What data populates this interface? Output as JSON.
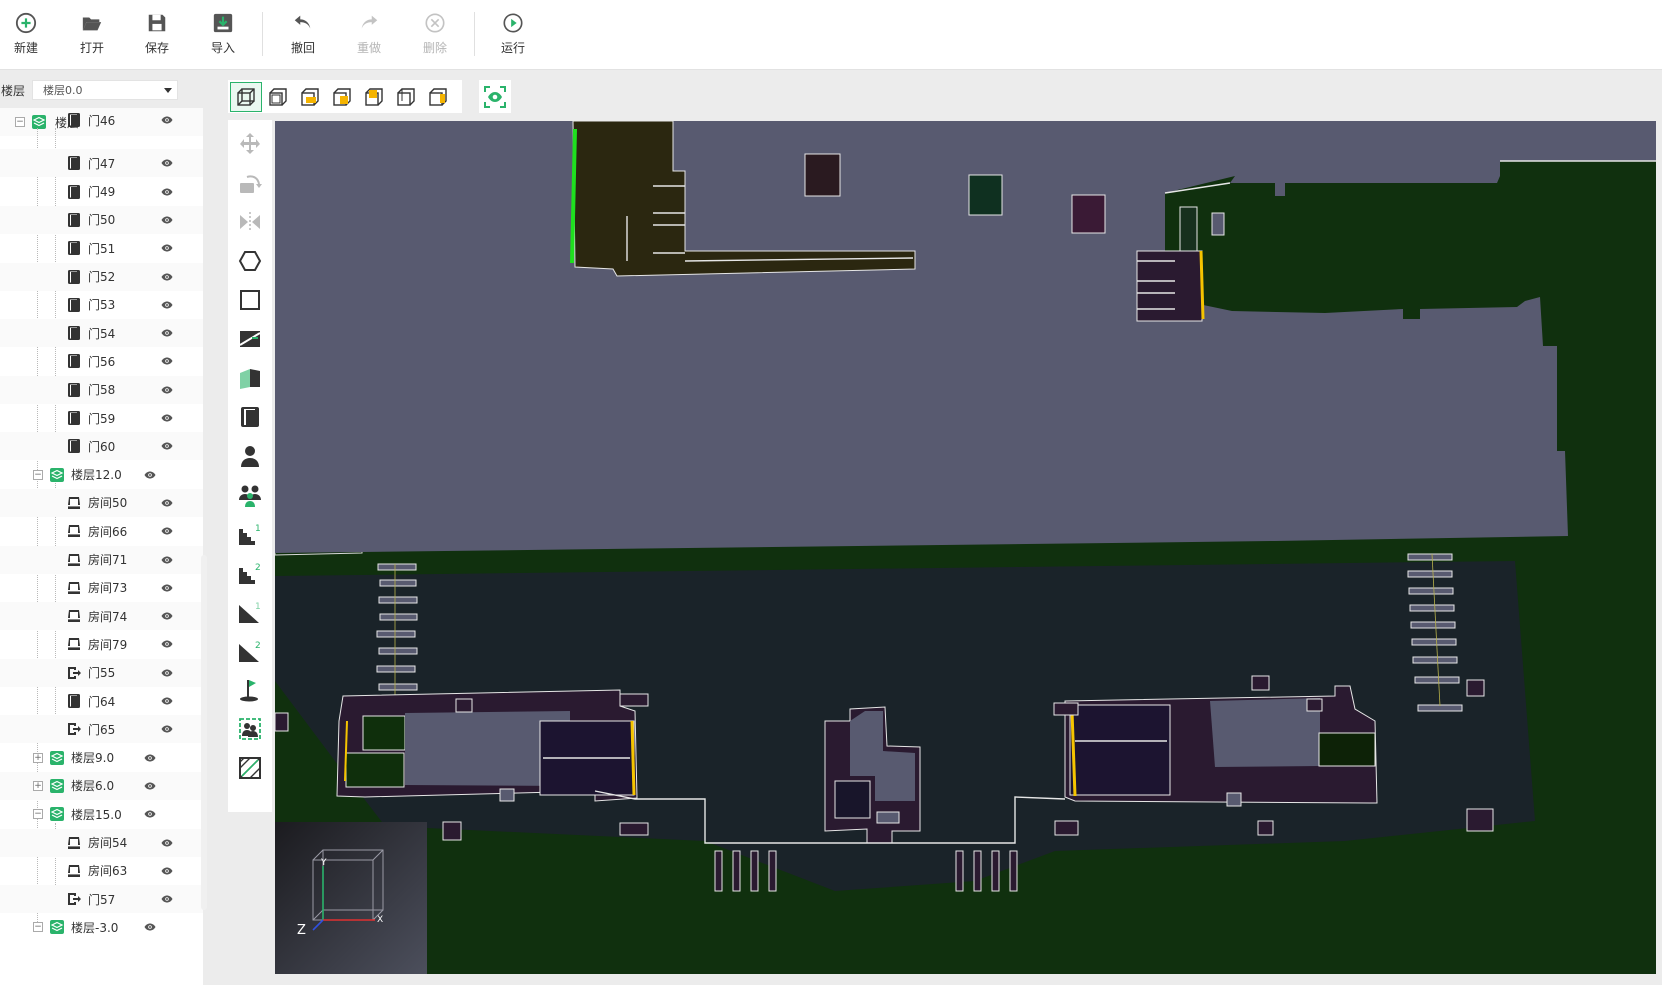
{
  "toolbar": {
    "new": "新建",
    "open": "打开",
    "save": "保存",
    "import": "导入",
    "undo": "撤回",
    "redo": "重做",
    "delete": "删除",
    "run": "运行"
  },
  "floor_selector": {
    "label": "楼层",
    "value": "楼层0.0"
  },
  "tree": {
    "root": "楼层",
    "items": [
      {
        "label": "门46",
        "type": "door"
      },
      {
        "label": "门47",
        "type": "door"
      },
      {
        "label": "门49",
        "type": "door"
      },
      {
        "label": "门50",
        "type": "door"
      },
      {
        "label": "门51",
        "type": "door"
      },
      {
        "label": "门52",
        "type": "door"
      },
      {
        "label": "门53",
        "type": "door"
      },
      {
        "label": "门54",
        "type": "door"
      },
      {
        "label": "门56",
        "type": "door"
      },
      {
        "label": "门58",
        "type": "door"
      },
      {
        "label": "门59",
        "type": "door"
      },
      {
        "label": "门60",
        "type": "door"
      },
      {
        "label": "楼层12.0",
        "type": "floor-open"
      },
      {
        "label": "房间50",
        "type": "room"
      },
      {
        "label": "房间66",
        "type": "room"
      },
      {
        "label": "房间71",
        "type": "room"
      },
      {
        "label": "房间73",
        "type": "room"
      },
      {
        "label": "房间74",
        "type": "room"
      },
      {
        "label": "房间79",
        "type": "room"
      },
      {
        "label": "门55",
        "type": "exit"
      },
      {
        "label": "门64",
        "type": "door"
      },
      {
        "label": "门65",
        "type": "exit"
      },
      {
        "label": "楼层9.0",
        "type": "floor-closed"
      },
      {
        "label": "楼层6.0",
        "type": "floor-closed"
      },
      {
        "label": "楼层15.0",
        "type": "floor-open"
      },
      {
        "label": "房间54",
        "type": "room"
      },
      {
        "label": "房间63",
        "type": "room"
      },
      {
        "label": "门57",
        "type": "exit"
      },
      {
        "label": "楼层-3.0",
        "type": "floor-open"
      }
    ]
  },
  "minimap": {
    "axis_x": "X",
    "axis_y": "Y",
    "axis_z": "Z"
  },
  "colors": {
    "accent": "#2ab36b",
    "ground": "#10300e",
    "floor_slab": "#585a70",
    "courtyard": "#1a2329",
    "room_dark": "#2a1a30"
  }
}
